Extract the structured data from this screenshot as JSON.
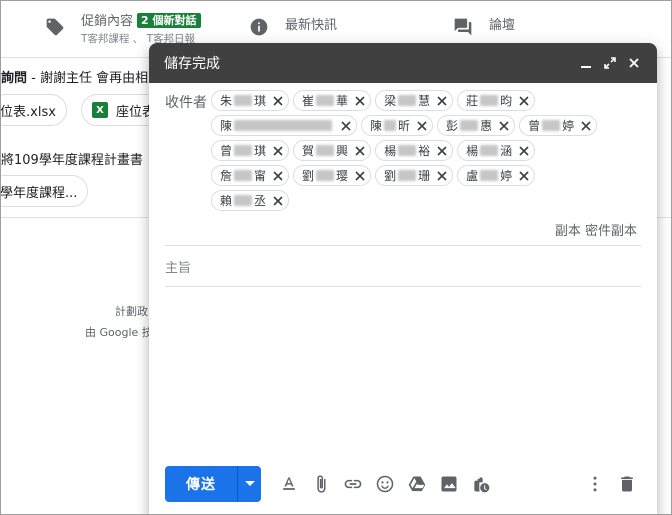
{
  "background": {
    "categories": [
      {
        "label": "促銷內容",
        "badge": "2 個新對話",
        "subtitle": "T客邦課程 、 T客邦日報",
        "icon": "tag-icon"
      },
      {
        "label": "最新快訊",
        "icon": "info-icon"
      },
      {
        "label": "論壇",
        "icon": "forum-icon"
      }
    ],
    "email_row": {
      "bold": "詢問",
      "text": " - 謝謝主任 會再由相"
    },
    "attachments": [
      "位表.xlsx",
      "座位表"
    ],
    "email_row2": "將109學年度課程計畫書",
    "chip2": "學年度課程...",
    "footer1": "計劃政",
    "footer2": "由 Google 技"
  },
  "compose": {
    "title": "儲存完成",
    "to_label": "收件者",
    "recipients": [
      {
        "a": "朱",
        "b": "琪",
        "w": 18
      },
      {
        "a": "崔",
        "b": "華",
        "w": 18
      },
      {
        "a": "梁",
        "b": "慧",
        "w": 18
      },
      {
        "a": "莊",
        "b": "昀",
        "w": 18
      },
      {
        "a": "陳",
        "b": "",
        "w": 98
      },
      {
        "a": "陳",
        "b": "昕",
        "w": 12
      },
      {
        "a": "彭",
        "b": "惠",
        "w": 18
      },
      {
        "a": "曾",
        "b": "婷",
        "w": 18
      },
      {
        "a": "曾",
        "b": "琪",
        "w": 18
      },
      {
        "a": "賀",
        "b": "興",
        "w": 18
      },
      {
        "a": "楊",
        "b": "裕",
        "w": 18
      },
      {
        "a": "楊",
        "b": "涵",
        "w": 18
      },
      {
        "a": "詹",
        "b": "甯",
        "w": 18
      },
      {
        "a": "劉",
        "b": "璎",
        "w": 18
      },
      {
        "a": "劉",
        "b": "珊",
        "w": 18
      },
      {
        "a": "盧",
        "b": "婷",
        "w": 18
      },
      {
        "a": "賴",
        "b": "丞",
        "w": 18
      }
    ],
    "cc_label": "副本 密件副本",
    "subject_placeholder": "主旨",
    "send_label": "傳送"
  }
}
